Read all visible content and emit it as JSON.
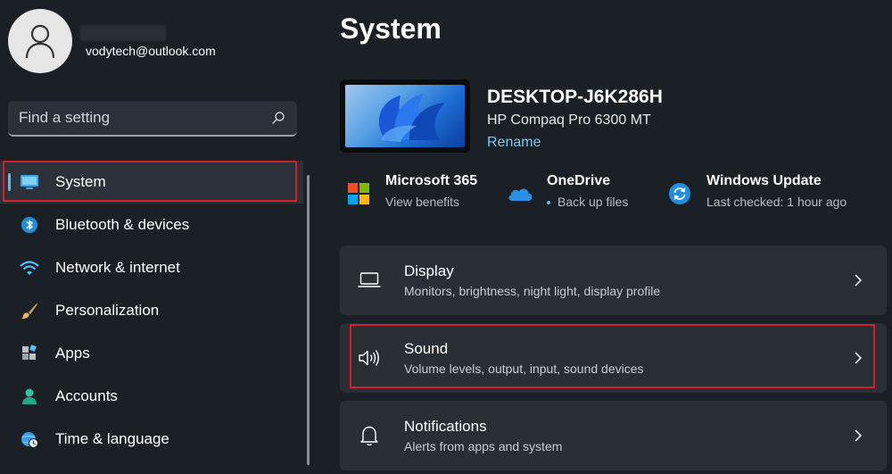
{
  "account": {
    "email": "vodytech@outlook.com"
  },
  "search": {
    "placeholder": "Find a setting"
  },
  "sidebar": {
    "items": [
      {
        "label": "System",
        "icon": "display-icon",
        "selected": true
      },
      {
        "label": "Bluetooth & devices",
        "icon": "bluetooth-icon"
      },
      {
        "label": "Network & internet",
        "icon": "wifi-icon"
      },
      {
        "label": "Personalization",
        "icon": "brush-icon"
      },
      {
        "label": "Apps",
        "icon": "apps-icon"
      },
      {
        "label": "Accounts",
        "icon": "person-icon"
      },
      {
        "label": "Time & language",
        "icon": "globe-clock-icon"
      }
    ]
  },
  "main": {
    "title": "System",
    "device": {
      "name": "DESKTOP-J6K286H",
      "model": "HP Compaq Pro 6300 MT",
      "rename": "Rename"
    },
    "quick_links": [
      {
        "title": "Microsoft 365",
        "subtitle": "View benefits",
        "icon": "microsoft-logo-icon"
      },
      {
        "title": "OneDrive",
        "subtitle": "Back up files",
        "icon": "cloud-icon"
      },
      {
        "title": "Windows Update",
        "subtitle": "Last checked: 1 hour ago",
        "icon": "sync-icon"
      }
    ],
    "cards": [
      {
        "title": "Display",
        "subtitle": "Monitors, brightness, night light, display profile",
        "icon": "laptop-icon"
      },
      {
        "title": "Sound",
        "subtitle": "Volume levels, output, input, sound devices",
        "icon": "speaker-icon",
        "highlighted": true
      },
      {
        "title": "Notifications",
        "subtitle": "Alerts from apps and system",
        "icon": "bell-icon"
      }
    ]
  },
  "colors": {
    "background": "#1b1f26",
    "card": "#2a2e35",
    "accent": "#4cc2ff",
    "link": "#7fc8f8",
    "highlight_box": "#d3202f"
  }
}
